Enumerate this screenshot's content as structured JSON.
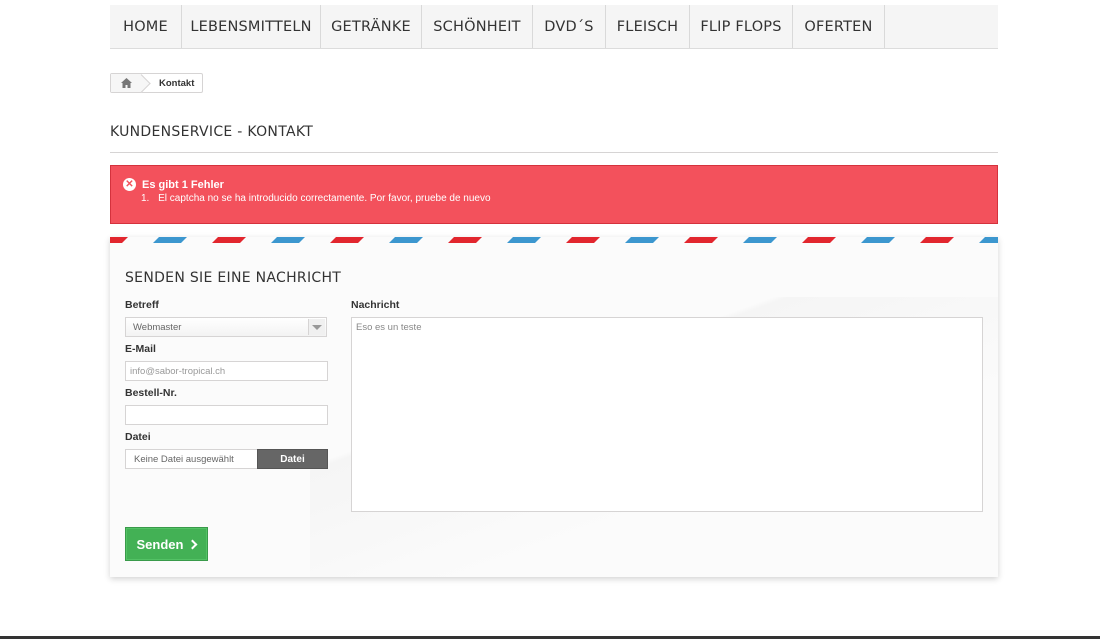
{
  "nav": {
    "items": [
      "Home",
      "Lebensmitteln",
      "Getränke",
      "Schönheit",
      "DVD´S",
      "Fleisch",
      "Flip Flops",
      "Oferten"
    ]
  },
  "breadcrumb": {
    "home_icon": "home-icon",
    "current": "Kontakt"
  },
  "page_heading": "Kundenservice - Kontakt",
  "alert": {
    "title": "Es gibt 1 Fehler",
    "icon": "error-circle-icon",
    "errors": [
      {
        "num": "1.",
        "text": "El captcha no se ha introducido correctamente. Por favor, pruebe de nuevo"
      }
    ]
  },
  "form": {
    "title": "Senden sie eine Nachricht",
    "subject_label": "Betreff",
    "subject_value": "Webmaster",
    "email_label": "E-Mail",
    "email_value": "info@sabor-tropical.ch",
    "order_label": "Bestell-Nr.",
    "order_value": "",
    "file_label": "Datei",
    "file_name": "Keine Datei ausgewählt",
    "file_button": "Datei",
    "message_label": "Nachricht",
    "message_value": "Eso es un teste",
    "submit_label": "Senden"
  },
  "colors": {
    "alert_bg": "#f3515c",
    "submit_bg": "#43b155",
    "stripe_red": "#e2262e",
    "stripe_blue": "#3c97cf"
  }
}
